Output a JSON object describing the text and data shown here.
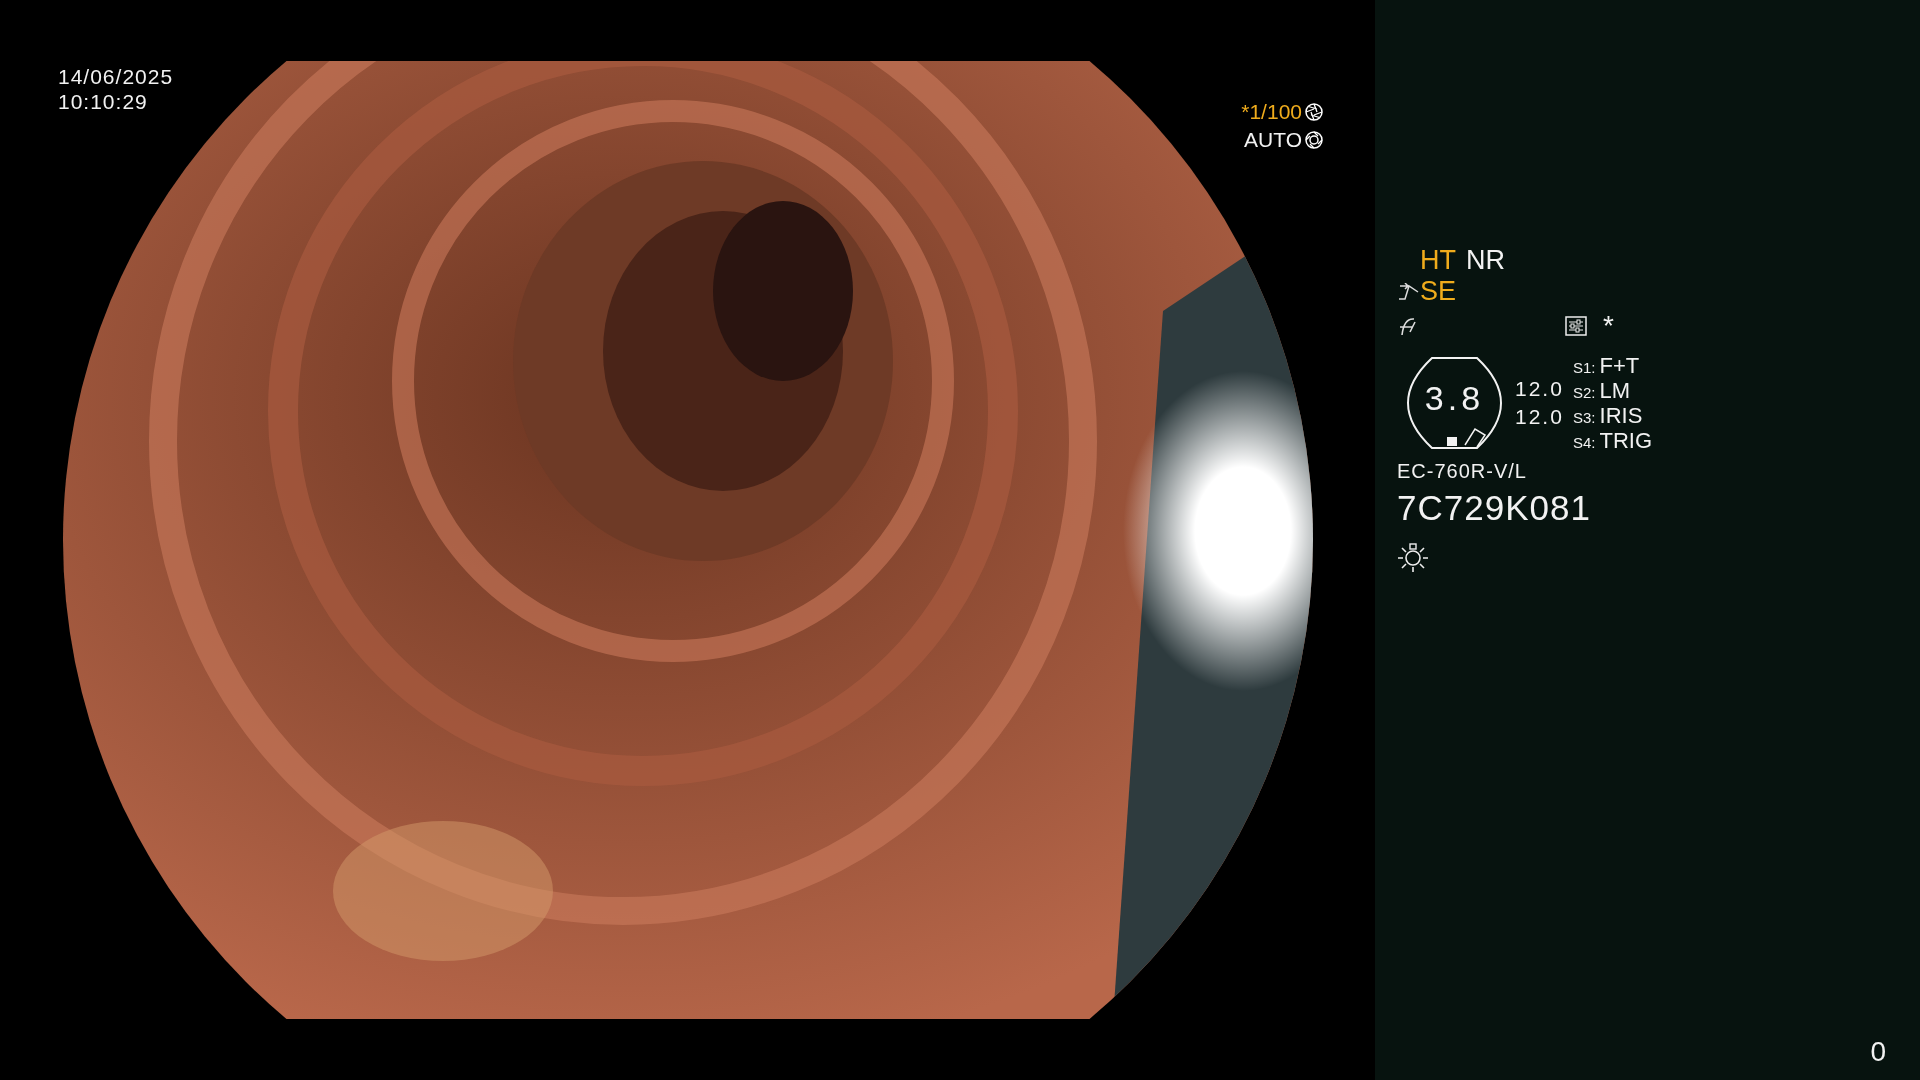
{
  "timestamp": {
    "date": "14/06/2025",
    "time": "10:10:29"
  },
  "exposure": {
    "shutter": "*1/100",
    "shutter_highlighted": true,
    "iris_mode": "AUTO"
  },
  "status": {
    "modes": [
      {
        "label": "HT",
        "active": true
      },
      {
        "label": "NR",
        "active": false
      }
    ],
    "enhancement": {
      "label": "SE",
      "active": true
    },
    "marker": "*",
    "gauge": {
      "reading": "3.8"
    },
    "values": [
      "12.0",
      "12.0"
    ],
    "switches": [
      {
        "key": "S1:",
        "value": "F+T"
      },
      {
        "key": "S2:",
        "value": "LM"
      },
      {
        "key": "S3:",
        "value": "IRIS"
      },
      {
        "key": "S4:",
        "value": "TRIG"
      }
    ],
    "scope_model": "EC-760R-V/L",
    "serial": "7C729K081"
  },
  "counter": "0"
}
